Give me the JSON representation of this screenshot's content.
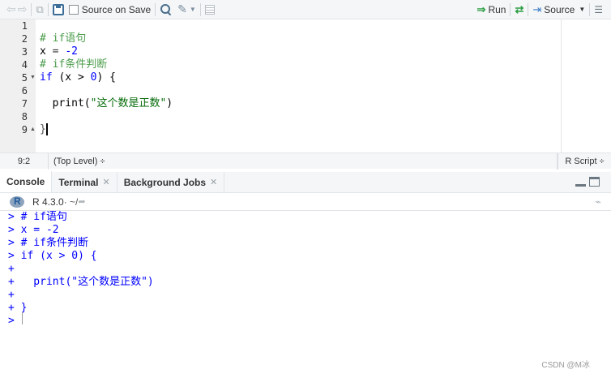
{
  "editor": {
    "toolbar": {
      "source_on_save": "Source on Save",
      "run": "Run",
      "source": "Source"
    },
    "line_numbers": [
      "1",
      "2",
      "3",
      "4",
      "5",
      "6",
      "7",
      "8",
      "9"
    ],
    "code": {
      "l2": "# if语句",
      "l3_var": "x",
      "l3_op": " = ",
      "l3_val": "-2",
      "l4": "# if条件判断",
      "l5_kw": "if",
      "l5_rest": " (x > ",
      "l5_num": "0",
      "l5_end": ") {",
      "l7_fn": "  print(",
      "l7_str": "\"这个数是正数\"",
      "l7_end": ")",
      "l9": "}"
    },
    "status": {
      "position": "9:2",
      "scope": "(Top Level) ÷",
      "language": "R Script ÷"
    }
  },
  "console": {
    "tabs": [
      {
        "label": "Console"
      },
      {
        "label": "Terminal"
      },
      {
        "label": "Background Jobs"
      }
    ],
    "r_version": "R 4.3.0",
    "working_dir": " · ~/ ",
    "lines": [
      "> # if语句",
      "> x = -2",
      "> # if条件判断",
      "> if (x > 0) {",
      "+ ",
      "+   print(\"这个数是正数\")",
      "+ ",
      "+ }",
      "> "
    ]
  },
  "watermark": "CSDN @M冰"
}
